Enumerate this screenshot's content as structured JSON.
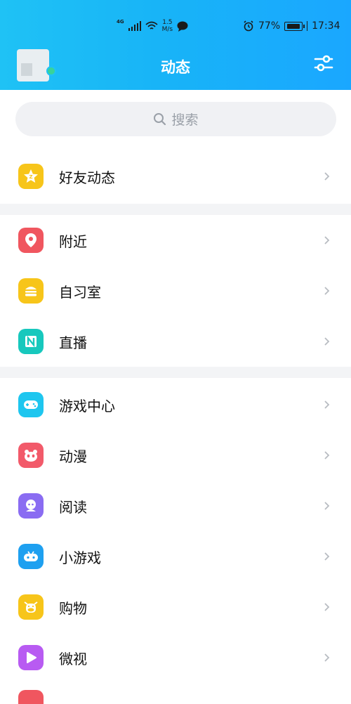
{
  "status_bar": {
    "network": "4G",
    "speed_value": "1.5",
    "speed_unit": "M/s",
    "battery": "77%",
    "time": "17:34"
  },
  "header": {
    "title": "动态",
    "filter_icon": "sliders-icon"
  },
  "search": {
    "placeholder": "搜索",
    "icon": "search-icon"
  },
  "groups": [
    {
      "items": [
        {
          "label": "好友动态",
          "icon": "star-icon",
          "color": "#f7c51a"
        }
      ]
    },
    {
      "items": [
        {
          "label": "附近",
          "icon": "location-pin-icon",
          "color": "#f0565f"
        },
        {
          "label": "自习室",
          "icon": "burger-icon",
          "color": "#f7c51a"
        },
        {
          "label": "直播",
          "icon": "live-n-icon",
          "color": "#17c8bd"
        }
      ]
    },
    {
      "items": [
        {
          "label": "游戏中心",
          "icon": "gamepad-icon",
          "color": "#1ec6ef"
        },
        {
          "label": "动漫",
          "icon": "panda-icon",
          "color": "#f25a6a"
        },
        {
          "label": "阅读",
          "icon": "character-icon",
          "color": "#8a6cf2"
        },
        {
          "label": "小游戏",
          "icon": "controller-icon",
          "color": "#1ea0f0"
        },
        {
          "label": "购物",
          "icon": "cow-icon",
          "color": "#f7c51a"
        },
        {
          "label": "微视",
          "icon": "play-icon",
          "color": "#b85bf2"
        }
      ]
    }
  ],
  "colors": {
    "header_start": "#1fc2f5",
    "header_end": "#1aa7ff",
    "separator": "#f3f4f6",
    "chevron": "#b8bcc2"
  }
}
